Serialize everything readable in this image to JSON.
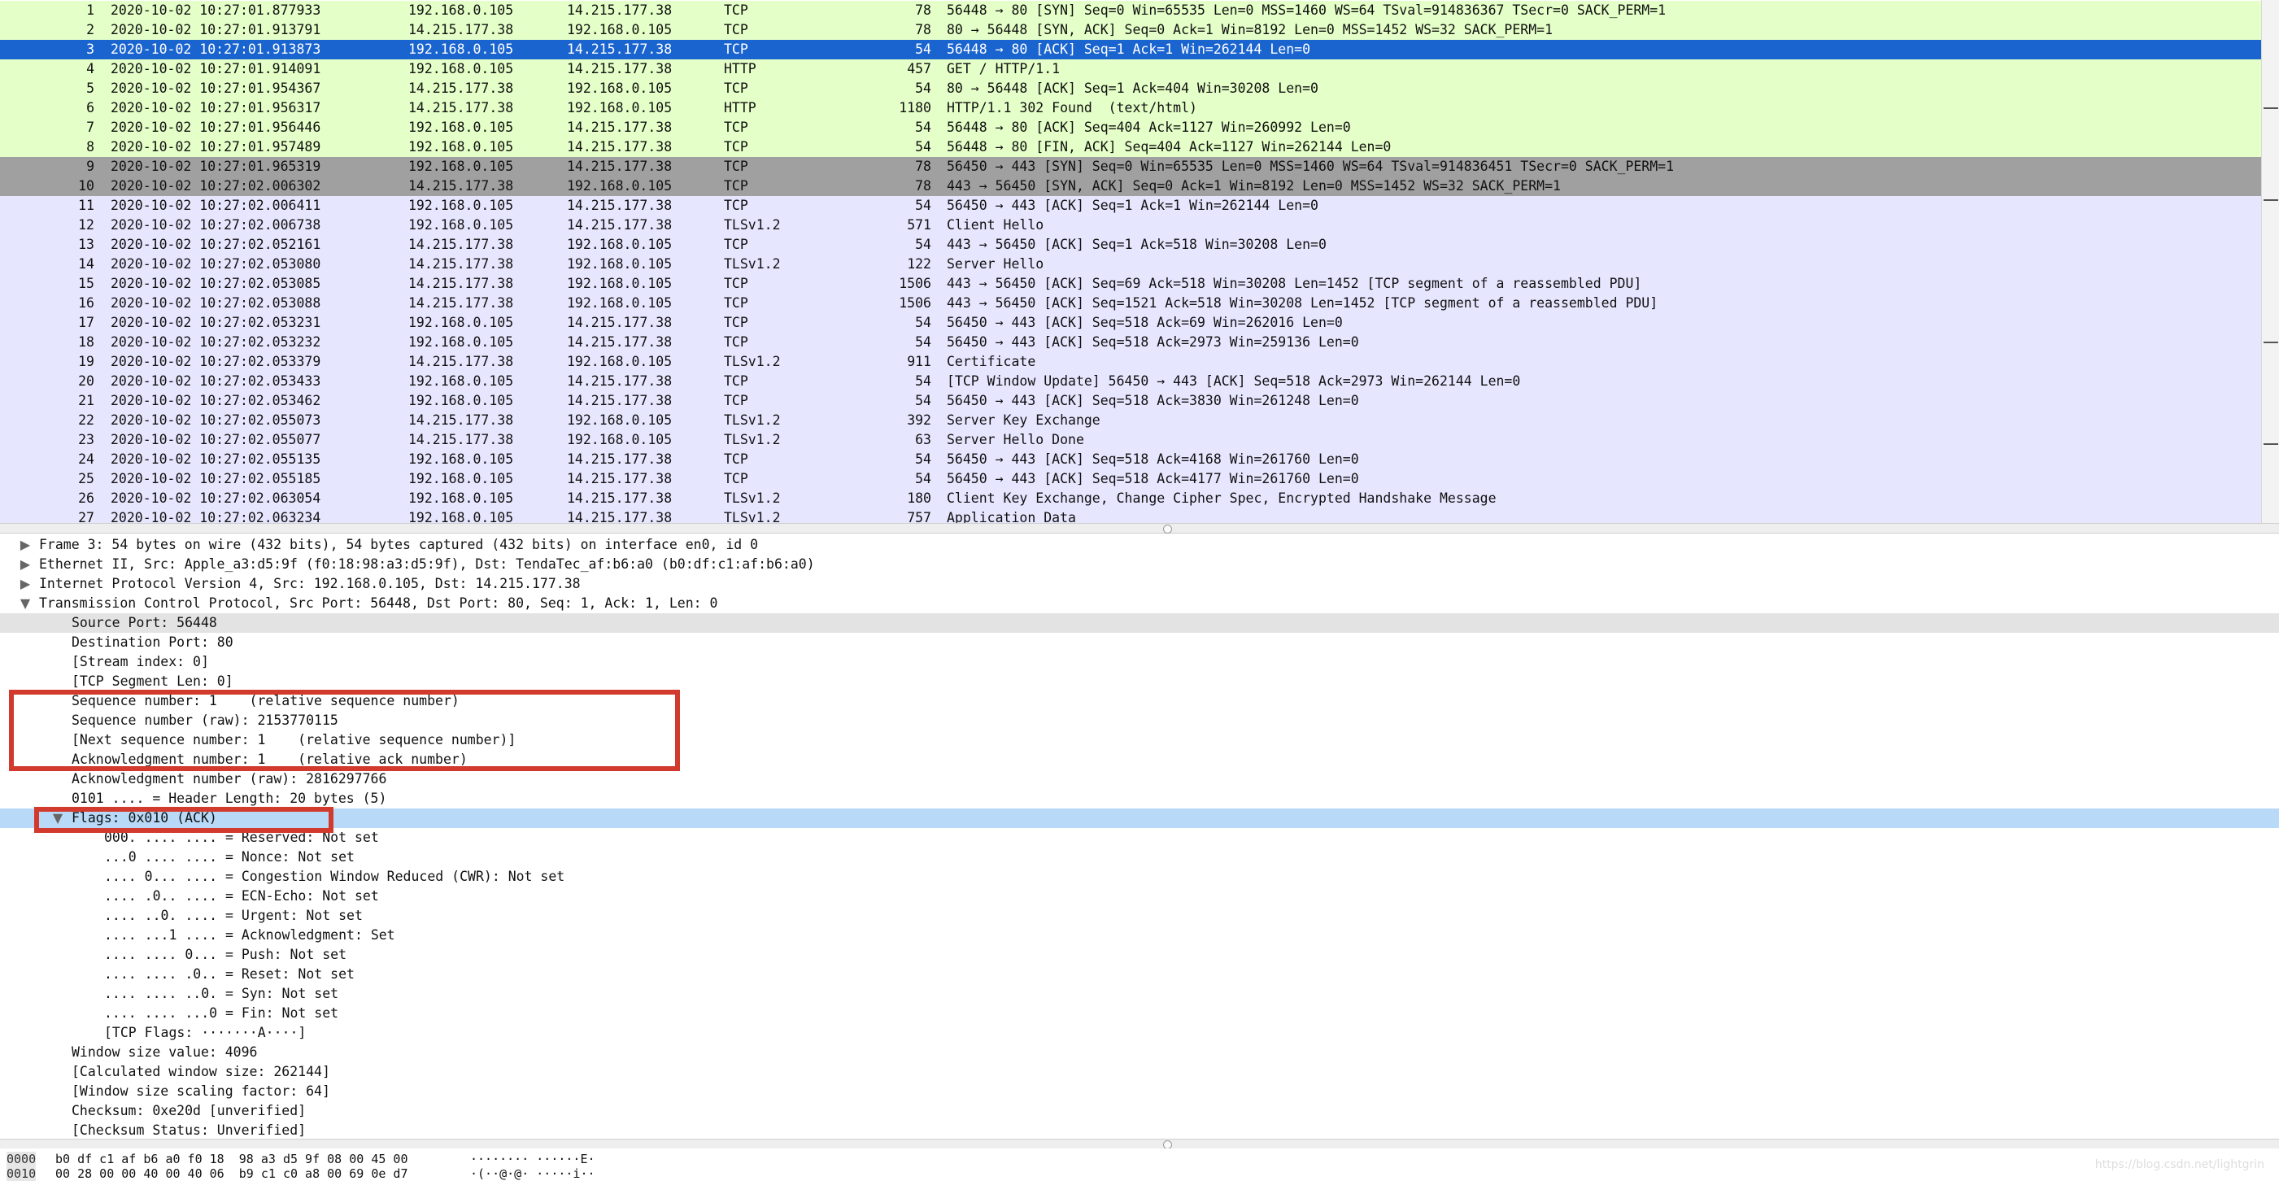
{
  "packets": [
    {
      "no": "1",
      "time": "2020-10-02 10:27:01.877933",
      "src": "192.168.0.105",
      "dst": "14.215.177.38",
      "proto": "TCP",
      "len": "78",
      "info": "56448 → 80 [SYN] Seq=0 Win=65535 Len=0 MSS=1460 WS=64 TSval=914836367 TSecr=0 SACK_PERM=1",
      "kind": "http"
    },
    {
      "no": "2",
      "time": "2020-10-02 10:27:01.913791",
      "src": "14.215.177.38",
      "dst": "192.168.0.105",
      "proto": "TCP",
      "len": "78",
      "info": "80 → 56448 [SYN, ACK] Seq=0 Ack=1 Win=8192 Len=0 MSS=1452 WS=32 SACK_PERM=1",
      "kind": "http"
    },
    {
      "no": "3",
      "time": "2020-10-02 10:27:01.913873",
      "src": "192.168.0.105",
      "dst": "14.215.177.38",
      "proto": "TCP",
      "len": "54",
      "info": "56448 → 80 [ACK] Seq=1 Ack=1 Win=262144 Len=0",
      "kind": "sel"
    },
    {
      "no": "4",
      "time": "2020-10-02 10:27:01.914091",
      "src": "192.168.0.105",
      "dst": "14.215.177.38",
      "proto": "HTTP",
      "len": "457",
      "info": "GET / HTTP/1.1",
      "kind": "http"
    },
    {
      "no": "5",
      "time": "2020-10-02 10:27:01.954367",
      "src": "14.215.177.38",
      "dst": "192.168.0.105",
      "proto": "TCP",
      "len": "54",
      "info": "80 → 56448 [ACK] Seq=1 Ack=404 Win=30208 Len=0",
      "kind": "http"
    },
    {
      "no": "6",
      "time": "2020-10-02 10:27:01.956317",
      "src": "14.215.177.38",
      "dst": "192.168.0.105",
      "proto": "HTTP",
      "len": "1180",
      "info": "HTTP/1.1 302 Found  (text/html)",
      "kind": "http"
    },
    {
      "no": "7",
      "time": "2020-10-02 10:27:01.956446",
      "src": "192.168.0.105",
      "dst": "14.215.177.38",
      "proto": "TCP",
      "len": "54",
      "info": "56448 → 80 [ACK] Seq=404 Ack=1127 Win=260992 Len=0",
      "kind": "http"
    },
    {
      "no": "8",
      "time": "2020-10-02 10:27:01.957489",
      "src": "192.168.0.105",
      "dst": "14.215.177.38",
      "proto": "TCP",
      "len": "54",
      "info": "56448 → 80 [FIN, ACK] Seq=404 Ack=1127 Win=262144 Len=0",
      "kind": "http"
    },
    {
      "no": "9",
      "time": "2020-10-02 10:27:01.965319",
      "src": "192.168.0.105",
      "dst": "14.215.177.38",
      "proto": "TCP",
      "len": "78",
      "info": "56450 → 443 [SYN] Seq=0 Win=65535 Len=0 MSS=1460 WS=64 TSval=914836451 TSecr=0 SACK_PERM=1",
      "kind": "syn"
    },
    {
      "no": "10",
      "time": "2020-10-02 10:27:02.006302",
      "src": "14.215.177.38",
      "dst": "192.168.0.105",
      "proto": "TCP",
      "len": "78",
      "info": "443 → 56450 [SYN, ACK] Seq=0 Ack=1 Win=8192 Len=0 MSS=1452 WS=32 SACK_PERM=1",
      "kind": "syn"
    },
    {
      "no": "11",
      "time": "2020-10-02 10:27:02.006411",
      "src": "192.168.0.105",
      "dst": "14.215.177.38",
      "proto": "TCP",
      "len": "54",
      "info": "56450 → 443 [ACK] Seq=1 Ack=1 Win=262144 Len=0",
      "kind": "tls"
    },
    {
      "no": "12",
      "time": "2020-10-02 10:27:02.006738",
      "src": "192.168.0.105",
      "dst": "14.215.177.38",
      "proto": "TLSv1.2",
      "len": "571",
      "info": "Client Hello",
      "kind": "tls"
    },
    {
      "no": "13",
      "time": "2020-10-02 10:27:02.052161",
      "src": "14.215.177.38",
      "dst": "192.168.0.105",
      "proto": "TCP",
      "len": "54",
      "info": "443 → 56450 [ACK] Seq=1 Ack=518 Win=30208 Len=0",
      "kind": "tls"
    },
    {
      "no": "14",
      "time": "2020-10-02 10:27:02.053080",
      "src": "14.215.177.38",
      "dst": "192.168.0.105",
      "proto": "TLSv1.2",
      "len": "122",
      "info": "Server Hello",
      "kind": "tls"
    },
    {
      "no": "15",
      "time": "2020-10-02 10:27:02.053085",
      "src": "14.215.177.38",
      "dst": "192.168.0.105",
      "proto": "TCP",
      "len": "1506",
      "info": "443 → 56450 [ACK] Seq=69 Ack=518 Win=30208 Len=1452 [TCP segment of a reassembled PDU]",
      "kind": "tls"
    },
    {
      "no": "16",
      "time": "2020-10-02 10:27:02.053088",
      "src": "14.215.177.38",
      "dst": "192.168.0.105",
      "proto": "TCP",
      "len": "1506",
      "info": "443 → 56450 [ACK] Seq=1521 Ack=518 Win=30208 Len=1452 [TCP segment of a reassembled PDU]",
      "kind": "tls"
    },
    {
      "no": "17",
      "time": "2020-10-02 10:27:02.053231",
      "src": "192.168.0.105",
      "dst": "14.215.177.38",
      "proto": "TCP",
      "len": "54",
      "info": "56450 → 443 [ACK] Seq=518 Ack=69 Win=262016 Len=0",
      "kind": "tls"
    },
    {
      "no": "18",
      "time": "2020-10-02 10:27:02.053232",
      "src": "192.168.0.105",
      "dst": "14.215.177.38",
      "proto": "TCP",
      "len": "54",
      "info": "56450 → 443 [ACK] Seq=518 Ack=2973 Win=259136 Len=0",
      "kind": "tls"
    },
    {
      "no": "19",
      "time": "2020-10-02 10:27:02.053379",
      "src": "14.215.177.38",
      "dst": "192.168.0.105",
      "proto": "TLSv1.2",
      "len": "911",
      "info": "Certificate",
      "kind": "tls"
    },
    {
      "no": "20",
      "time": "2020-10-02 10:27:02.053433",
      "src": "192.168.0.105",
      "dst": "14.215.177.38",
      "proto": "TCP",
      "len": "54",
      "info": "[TCP Window Update] 56450 → 443 [ACK] Seq=518 Ack=2973 Win=262144 Len=0",
      "kind": "tls"
    },
    {
      "no": "21",
      "time": "2020-10-02 10:27:02.053462",
      "src": "192.168.0.105",
      "dst": "14.215.177.38",
      "proto": "TCP",
      "len": "54",
      "info": "56450 → 443 [ACK] Seq=518 Ack=3830 Win=261248 Len=0",
      "kind": "tls"
    },
    {
      "no": "22",
      "time": "2020-10-02 10:27:02.055073",
      "src": "14.215.177.38",
      "dst": "192.168.0.105",
      "proto": "TLSv1.2",
      "len": "392",
      "info": "Server Key Exchange",
      "kind": "tls"
    },
    {
      "no": "23",
      "time": "2020-10-02 10:27:02.055077",
      "src": "14.215.177.38",
      "dst": "192.168.0.105",
      "proto": "TLSv1.2",
      "len": "63",
      "info": "Server Hello Done",
      "kind": "tls"
    },
    {
      "no": "24",
      "time": "2020-10-02 10:27:02.055135",
      "src": "192.168.0.105",
      "dst": "14.215.177.38",
      "proto": "TCP",
      "len": "54",
      "info": "56450 → 443 [ACK] Seq=518 Ack=4168 Win=261760 Len=0",
      "kind": "tls"
    },
    {
      "no": "25",
      "time": "2020-10-02 10:27:02.055185",
      "src": "192.168.0.105",
      "dst": "14.215.177.38",
      "proto": "TCP",
      "len": "54",
      "info": "56450 → 443 [ACK] Seq=518 Ack=4177 Win=261760 Len=0",
      "kind": "tls"
    },
    {
      "no": "26",
      "time": "2020-10-02 10:27:02.063054",
      "src": "192.168.0.105",
      "dst": "14.215.177.38",
      "proto": "TLSv1.2",
      "len": "180",
      "info": "Client Key Exchange, Change Cipher Spec, Encrypted Handshake Message",
      "kind": "tls"
    },
    {
      "no": "27",
      "time": "2020-10-02 10:27:02.063234",
      "src": "192.168.0.105",
      "dst": "14.215.177.38",
      "proto": "TLSv1.2",
      "len": "757",
      "info": "Application Data",
      "kind": "tls"
    }
  ],
  "details": [
    {
      "text": "Frame 3: 54 bytes on wire (432 bits), 54 bytes captured (432 bits) on interface en0, id 0",
      "indent": 0,
      "tri": "collapsed"
    },
    {
      "text": "Ethernet II, Src: Apple_a3:d5:9f (f0:18:98:a3:d5:9f), Dst: TendaTec_af:b6:a0 (b0:df:c1:af:b6:a0)",
      "indent": 0,
      "tri": "collapsed"
    },
    {
      "text": "Internet Protocol Version 4, Src: 192.168.0.105, Dst: 14.215.177.38",
      "indent": 0,
      "tri": "collapsed"
    },
    {
      "text": "Transmission Control Protocol, Src Port: 56448, Dst Port: 80, Seq: 1, Ack: 1, Len: 0",
      "indent": 0,
      "tri": "expanded"
    },
    {
      "text": "Source Port: 56448",
      "indent": 1,
      "hl": "src"
    },
    {
      "text": "Destination Port: 80",
      "indent": 1
    },
    {
      "text": "[Stream index: 0]",
      "indent": 1
    },
    {
      "text": "[TCP Segment Len: 0]",
      "indent": 1
    },
    {
      "text": "Sequence number: 1    (relative sequence number)",
      "indent": 1
    },
    {
      "text": "Sequence number (raw): 2153770115",
      "indent": 1
    },
    {
      "text": "[Next sequence number: 1    (relative sequence number)]",
      "indent": 1
    },
    {
      "text": "Acknowledgment number: 1    (relative ack number)",
      "indent": 1
    },
    {
      "text": "Acknowledgment number (raw): 2816297766",
      "indent": 1
    },
    {
      "text": "0101 .... = Header Length: 20 bytes (5)",
      "indent": 1
    },
    {
      "text": "Flags: 0x010 (ACK)",
      "indent": 1,
      "tri": "expanded",
      "hl": "sel"
    },
    {
      "text": "000. .... .... = Reserved: Not set",
      "indent": 2
    },
    {
      "text": "...0 .... .... = Nonce: Not set",
      "indent": 2
    },
    {
      "text": ".... 0... .... = Congestion Window Reduced (CWR): Not set",
      "indent": 2
    },
    {
      "text": ".... .0.. .... = ECN-Echo: Not set",
      "indent": 2
    },
    {
      "text": ".... ..0. .... = Urgent: Not set",
      "indent": 2
    },
    {
      "text": ".... ...1 .... = Acknowledgment: Set",
      "indent": 2
    },
    {
      "text": ".... .... 0... = Push: Not set",
      "indent": 2
    },
    {
      "text": ".... .... .0.. = Reset: Not set",
      "indent": 2
    },
    {
      "text": ".... .... ..0. = Syn: Not set",
      "indent": 2
    },
    {
      "text": ".... .... ...0 = Fin: Not set",
      "indent": 2
    },
    {
      "text": "[TCP Flags: ·······A····]",
      "indent": 2
    },
    {
      "text": "Window size value: 4096",
      "indent": 1
    },
    {
      "text": "[Calculated window size: 262144]",
      "indent": 1
    },
    {
      "text": "[Window size scaling factor: 64]",
      "indent": 1
    },
    {
      "text": "Checksum: 0xe20d [unverified]",
      "indent": 1
    },
    {
      "text": "[Checksum Status: Unverified]",
      "indent": 1
    }
  ],
  "bytes": [
    {
      "offset": "0000",
      "hex": "b0 df c1 af b6 a0 f0 18  98 a3 d5 9f 08 00 45 00",
      "ascii": "········ ······E·"
    },
    {
      "offset": "0010",
      "hex": "00 28 00 00 40 00 40 06  b9 c1 c0 a8 00 69 0e d7",
      "ascii": "·(··@·@· ·····i··"
    }
  ],
  "watermark": "https://blog.csdn.net/lightgrin",
  "colors": {
    "http_row": "#e4ffc7",
    "tls_row": "#e7e6ff",
    "syn_row": "#a0a0a0",
    "selected_row": "#1a64d0",
    "selected_detail": "#b8daf8",
    "annotation_box": "#d23a2d"
  }
}
